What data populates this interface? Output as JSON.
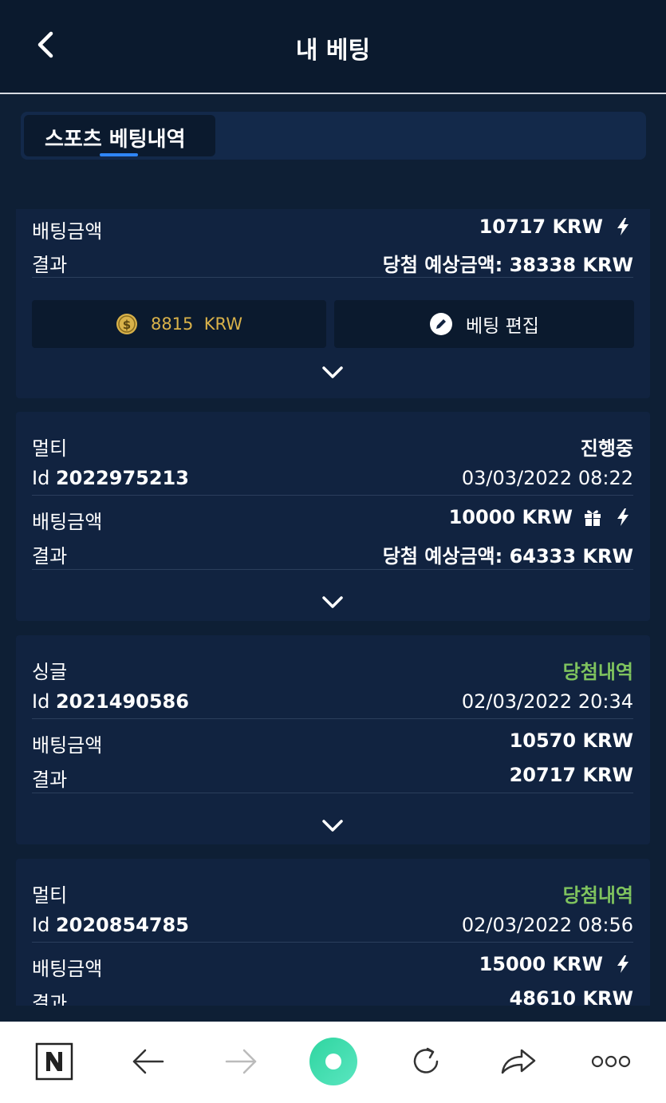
{
  "header": {
    "title": "내 베팅"
  },
  "tabs": [
    {
      "label": "스포츠 베팅내역"
    }
  ],
  "bets": [
    {
      "stake_label": "배팅금액",
      "stake": "10717 KRW",
      "result_label": "결과",
      "result": "당첨 예상금액: 38338 KRW",
      "cashout": "8815  KRW",
      "edit_label": "베팅 편집"
    },
    {
      "type": "멀티",
      "status": "진행중",
      "id_prefix": "Id",
      "id": "2022975213",
      "datetime": "03/03/2022 08:22",
      "stake_label": "배팅금액",
      "stake": "10000 KRW",
      "result_label": "결과",
      "result": "당첨 예상금액: 64333 KRW"
    },
    {
      "type": "싱글",
      "status": "당첨내역",
      "id_prefix": "Id",
      "id": "2021490586",
      "datetime": "02/03/2022 20:34",
      "stake_label": "배팅금액",
      "stake": "10570 KRW",
      "result_label": "결과",
      "result": "20717 KRW"
    },
    {
      "type": "멀티",
      "status": "당첨내역",
      "id_prefix": "Id",
      "id": "2020854785",
      "datetime": "02/03/2022 08:56",
      "stake_label": "배팅금액",
      "stake": "15000 KRW",
      "result_label": "결과",
      "result": "48610 KRW"
    }
  ],
  "colors": {
    "background": "#0e1f35",
    "card": "#112340",
    "accent": "#2f86f6",
    "win": "#7fc35e",
    "coin": "#d9b24a"
  },
  "icons": [
    "chevron-left-icon",
    "lightning-icon",
    "gift-icon",
    "coin-icon",
    "pencil-icon",
    "chevron-down-icon",
    "n-logo-icon",
    "arrow-left-icon",
    "arrow-right-icon",
    "home-circle-icon",
    "refresh-icon",
    "share-icon",
    "more-icon"
  ]
}
